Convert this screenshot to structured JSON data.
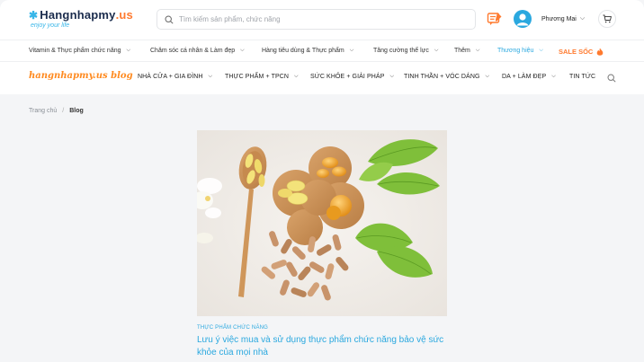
{
  "header": {
    "logo_main": "Hangnhapmy",
    "logo_tld": ".us",
    "logo_tagline": "enjoy your life",
    "search_placeholder": "Tìm kiếm sản phẩm, chức năng",
    "user_name": "Phương Mai"
  },
  "categories": [
    {
      "label": "Vitamin & Thực phẩm chức năng"
    },
    {
      "label": "Chăm sóc cá nhân & Làm đẹp"
    },
    {
      "label": "Hàng tiêu dùng & Thực phẩm"
    },
    {
      "label": "Tăng cường thể lực"
    },
    {
      "label": "Thêm"
    },
    {
      "label": "Thương hiệu"
    },
    {
      "label": "SALE SỐC"
    }
  ],
  "blog_nav": {
    "logo": "hangnhapmy.us blog",
    "items": [
      {
        "label": "NHÀ CỬA + GIA ĐÌNH"
      },
      {
        "label": "THỰC PHẨM + TPCN"
      },
      {
        "label": "SỨC KHỎE + GIẢI PHÁP"
      },
      {
        "label": "TINH THẦN + VÓC DÁNG"
      },
      {
        "label": "DA + LÀM ĐẸP"
      },
      {
        "label": "TIN TỨC"
      }
    ]
  },
  "breadcrumb": {
    "home": "Trang chủ",
    "separator": "/",
    "current": "Blog"
  },
  "article": {
    "category": "THỰC PHẨM CHỨC NĂNG",
    "title": "Lưu ý việc mua và sử dụng thực phẩm chức năng bảo vệ sức khỏe của mọi nhà"
  },
  "colors": {
    "accent": "#2aa8df",
    "brand_orange": "#ff7a2f",
    "navy": "#1a2b4c"
  }
}
